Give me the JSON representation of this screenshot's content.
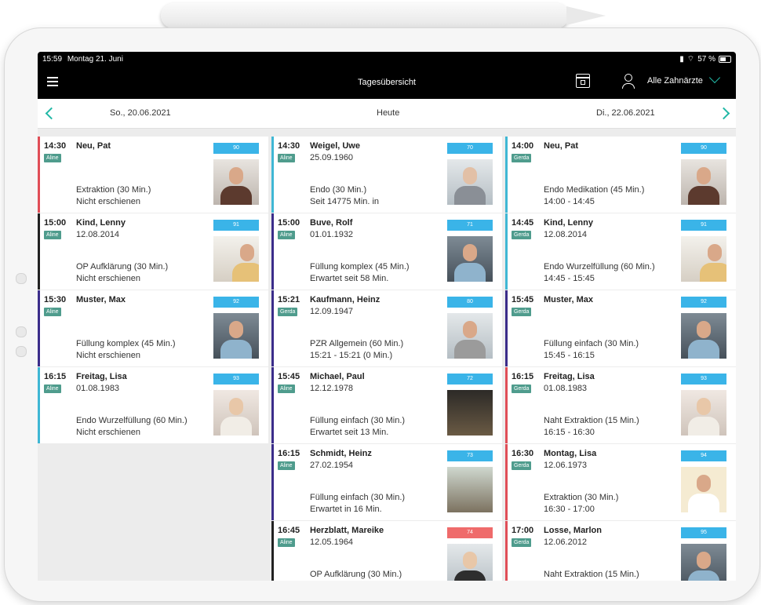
{
  "status": {
    "time": "15:59",
    "date": "Montag 21. Juni",
    "battery": "57 %"
  },
  "nav": {
    "title": "Tagesübersicht",
    "dentist_filter": "Alle Zahnärzte"
  },
  "datebar": {
    "prev": "So., 20.06.2021",
    "today": "Heute",
    "next": "Di., 22.06.2021"
  },
  "columns": [
    {
      "cards": [
        {
          "time": "14:30",
          "tag": "Aline",
          "name": "Neu, Pat",
          "dob": "",
          "treatment": "Extraktion (30 Min.)",
          "status": "Nicht erschienen",
          "number": "90",
          "number_color": "#3ab4e8",
          "bar_color": "#e04e57"
        },
        {
          "time": "15:00",
          "tag": "Aline",
          "name": "Kind, Lenny",
          "dob": "12.08.2014",
          "treatment": "OP Aufklärung (30 Min.)",
          "status": "Nicht erschienen",
          "number": "91",
          "number_color": "#3ab4e8",
          "bar_color": "#222222"
        },
        {
          "time": "15:30",
          "tag": "Aline",
          "name": "Muster, Max",
          "dob": "",
          "treatment": "Füllung komplex (45 Min.)",
          "status": "Nicht erschienen",
          "number": "92",
          "number_color": "#3ab4e8",
          "bar_color": "#3b2d8a"
        },
        {
          "time": "16:15",
          "tag": "Aline",
          "name": "Freitag, Lisa",
          "dob": "01.08.1983",
          "treatment": "Endo Wurzelfüllung (60 Min.)",
          "status": "Nicht erschienen",
          "number": "93",
          "number_color": "#3ab4e8",
          "bar_color": "#3fb7d4"
        }
      ]
    },
    {
      "cards": [
        {
          "time": "14:30",
          "tag": "Aline",
          "name": "Weigel, Uwe",
          "dob": "25.09.1960",
          "treatment": "Endo (30 Min.)",
          "status": "Seit 14775 Min. in",
          "number": "70",
          "number_color": "#3ab4e8",
          "bar_color": "#3fb7d4"
        },
        {
          "time": "15:00",
          "tag": "Aline",
          "name": "Buve, Rolf",
          "dob": "01.01.1932",
          "treatment": "Füllung komplex (45 Min.)",
          "status": "Erwartet seit 58 Min.",
          "number": "71",
          "number_color": "#3ab4e8",
          "bar_color": "#3b2d8a"
        },
        {
          "time": "15:21",
          "tag": "Gerda",
          "name": "Kaufmann, Heinz",
          "dob": "12.09.1947",
          "treatment": "PZR Allgemein (60 Min.)",
          "status": "15:21 - 15:21 (0 Min.)",
          "number": "80",
          "number_color": "#3ab4e8",
          "bar_color": "#3b2d8a"
        },
        {
          "time": "15:45",
          "tag": "Aline",
          "name": "Michael, Paul",
          "dob": "12.12.1978",
          "treatment": "Füllung einfach (30 Min.)",
          "status": "Erwartet seit 13 Min.",
          "number": "72",
          "number_color": "#3ab4e8",
          "bar_color": "#3b2d8a"
        },
        {
          "time": "16:15",
          "tag": "Aline",
          "name": "Schmidt, Heinz",
          "dob": "27.02.1954",
          "treatment": "Füllung einfach (30 Min.)",
          "status": "Erwartet in 16 Min.",
          "number": "73",
          "number_color": "#3ab4e8",
          "bar_color": "#3b2d8a"
        },
        {
          "time": "16:45",
          "tag": "Aline",
          "name": "Herzblatt, Mareike",
          "dob": "12.05.1964",
          "treatment": "OP Aufklärung (30 Min.)",
          "status": "",
          "number": "74",
          "number_color": "#ef6b6b",
          "bar_color": "#222222"
        }
      ]
    },
    {
      "cards": [
        {
          "time": "14:00",
          "tag": "Gerda",
          "name": "Neu, Pat",
          "dob": "",
          "treatment": "Endo Medikation (45 Min.)",
          "status": "14:00 - 14:45",
          "number": "90",
          "number_color": "#3ab4e8",
          "bar_color": "#3fb7d4"
        },
        {
          "time": "14:45",
          "tag": "Gerda",
          "name": "Kind, Lenny",
          "dob": "12.08.2014",
          "treatment": "Endo Wurzelfüllung (60 Min.)",
          "status": "14:45 - 15:45",
          "number": "91",
          "number_color": "#3ab4e8",
          "bar_color": "#3fb7d4"
        },
        {
          "time": "15:45",
          "tag": "Gerda",
          "name": "Muster, Max",
          "dob": "",
          "treatment": "Füllung einfach (30 Min.)",
          "status": "15:45 - 16:15",
          "number": "92",
          "number_color": "#3ab4e8",
          "bar_color": "#3b2d8a"
        },
        {
          "time": "16:15",
          "tag": "Gerda",
          "name": "Freitag, Lisa",
          "dob": "01.08.1983",
          "treatment": "Naht Extraktion (15 Min.)",
          "status": "16:15 - 16:30",
          "number": "93",
          "number_color": "#3ab4e8",
          "bar_color": "#e04e57"
        },
        {
          "time": "16:30",
          "tag": "Gerda",
          "name": "Montag, Lisa",
          "dob": "12.06.1973",
          "treatment": "Extraktion (30 Min.)",
          "status": "16:30 - 17:00",
          "number": "94",
          "number_color": "#3ab4e8",
          "bar_color": "#e04e57"
        },
        {
          "time": "17:00",
          "tag": "Gerda",
          "name": "Losse, Marlon",
          "dob": "12.06.2012",
          "treatment": "Naht Extraktion (15 Min.)",
          "status": "",
          "number": "95",
          "number_color": "#3ab4e8",
          "bar_color": "#e04e57"
        }
      ]
    }
  ]
}
